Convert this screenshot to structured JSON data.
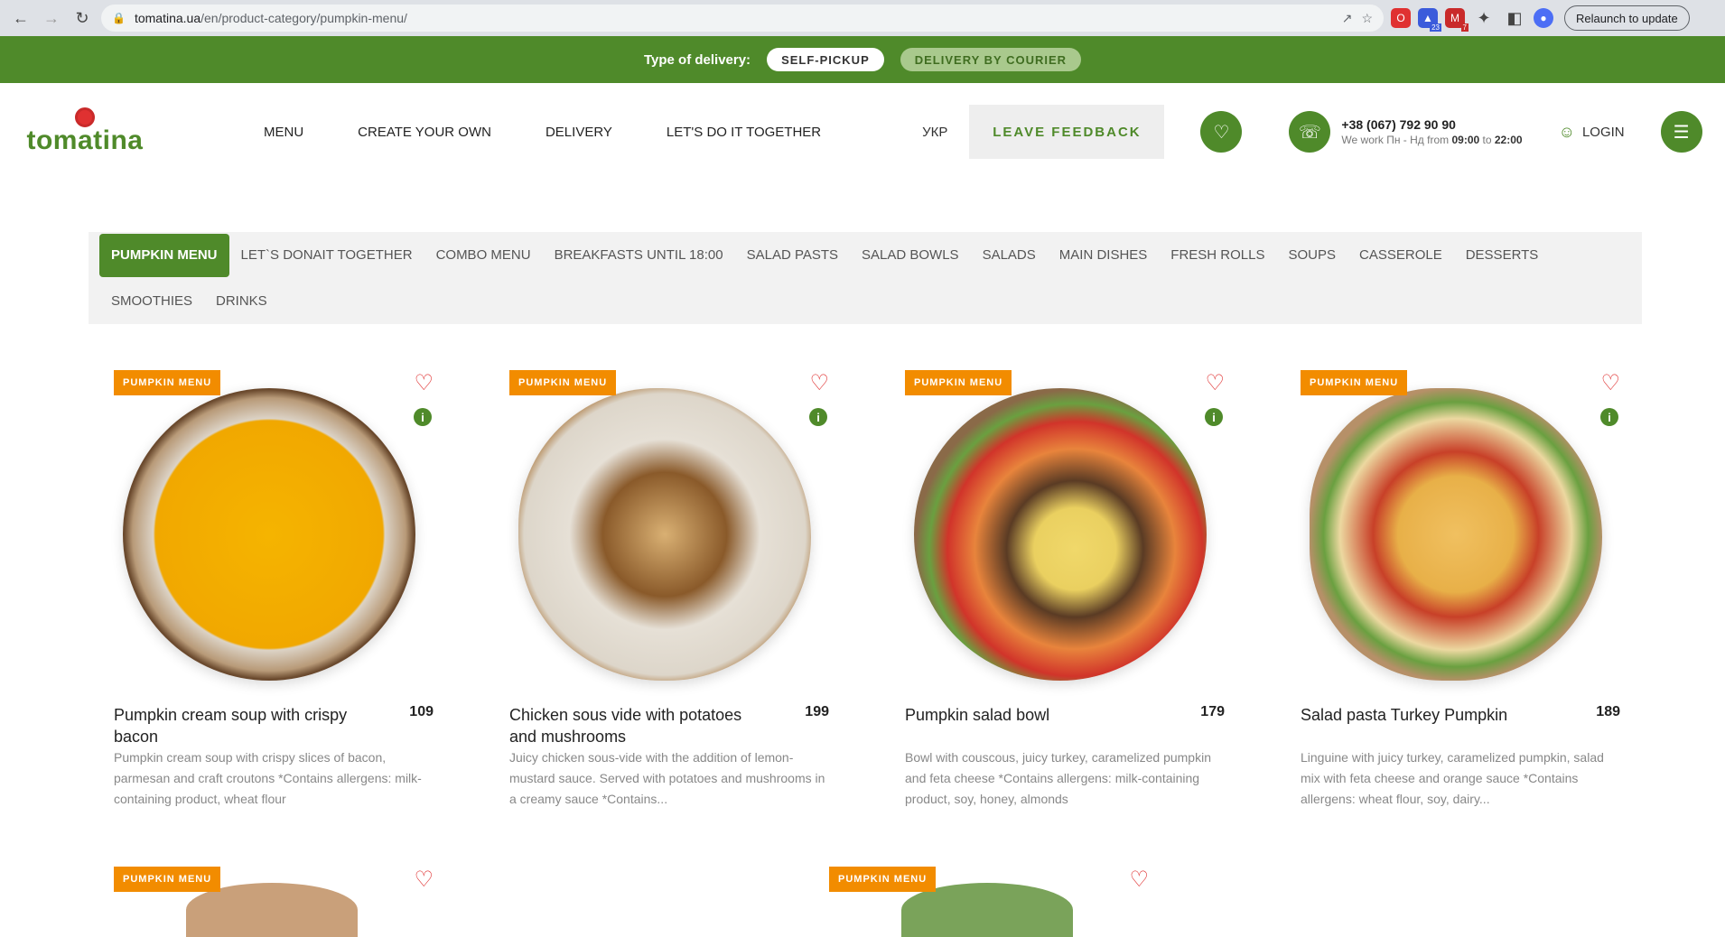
{
  "browser": {
    "url_host": "tomatina.ua",
    "url_path": "/en/product-category/pumpkin-menu/",
    "relaunch_label": "Relaunch to update",
    "ext_badges": [
      "23",
      "7"
    ]
  },
  "delivery": {
    "label": "Type of delivery:",
    "options": [
      "SELF-PICKUP",
      "DELIVERY BY COURIER"
    ]
  },
  "header": {
    "logo_text": "tomatina",
    "nav": [
      "MENU",
      "CREATE YOUR OWN",
      "DELIVERY",
      "LET'S DO IT TOGETHER"
    ],
    "lang": "УКР",
    "feedback": "LEAVE FEEDBACK",
    "phone": "+38 (067) 792 90 90",
    "hours_prefix": "We work Пн - Нд from ",
    "hours_from": "09:00",
    "hours_mid": " to ",
    "hours_to": "22:00",
    "login": "LOGIN"
  },
  "categories": [
    "PUMPKIN MENU",
    "LET`S DONAIT TOGETHER",
    "COMBO MENU",
    "BREAKFASTS UNTIL 18:00",
    "SALAD PASTS",
    "SALAD BOWLS",
    "SALADS",
    "MAIN DISHES",
    "FRESH ROLLS",
    "SOUPS",
    "CASSEROLE",
    "DESSERTS",
    "SMOOTHIES",
    "DRINKS"
  ],
  "products": [
    {
      "badge": "PUMPKIN MENU",
      "title": "Pumpkin cream soup with crispy bacon",
      "price": "109",
      "desc": "Pumpkin cream soup with crispy slices of bacon, parmesan and craft croutons *Contains allergens: milk-containing product, wheat flour"
    },
    {
      "badge": "PUMPKIN MENU",
      "title": "Chicken sous vide with potatoes and mushrooms",
      "price": "199",
      "desc": "Juicy chicken sous-vide with the addition of lemon-mustard sauce. Served with potatoes and mushrooms in a creamy sauce *Contains..."
    },
    {
      "badge": "PUMPKIN MENU",
      "title": "Pumpkin salad bowl",
      "price": "179",
      "desc": "Bowl with couscous, juicy turkey, caramelized pumpkin and feta cheese *Contains allergens: milk-containing product, soy, honey, almonds"
    },
    {
      "badge": "PUMPKIN MENU",
      "title": "Salad pasta Turkey Pumpkin",
      "price": "189",
      "desc": "Linguine with juicy turkey, caramelized pumpkin, salad mix with feta cheese and orange sauce *Contains allergens: wheat flour, soy, dairy..."
    }
  ],
  "more_products": [
    {
      "badge": "PUMPKIN MENU"
    },
    {
      "badge": "PUMPKIN MENU"
    }
  ]
}
